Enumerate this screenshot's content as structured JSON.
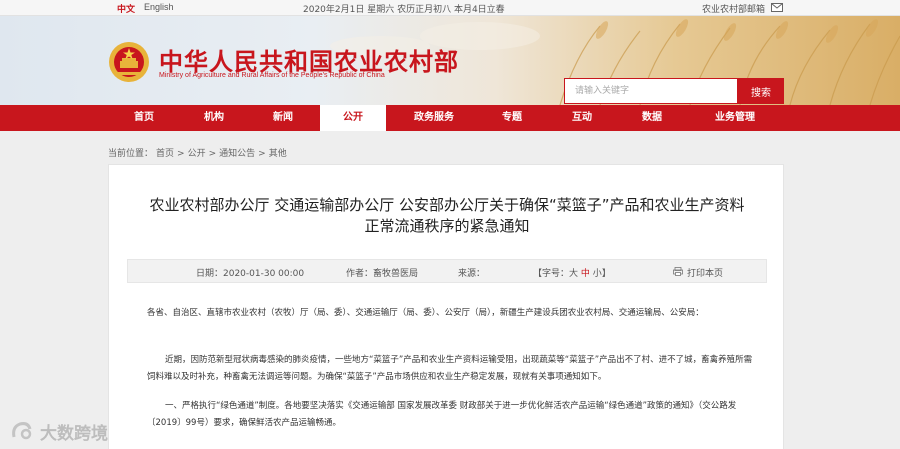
{
  "topbar": {
    "lang_zh": "中文",
    "lang_en": "English",
    "date_line": "2020年2月1日 星期六 农历正月初八 本月4日立春",
    "mailbox": "农业农村部邮箱"
  },
  "header": {
    "title": "中华人民共和国农业农村部",
    "subtitle": "Ministry of Agriculture and Rural Affairs of the People's Republic of China",
    "search_placeholder": "请输入关键字",
    "search_button": "搜索"
  },
  "nav": {
    "items": [
      {
        "label": "首页"
      },
      {
        "label": "机构"
      },
      {
        "label": "新闻"
      },
      {
        "label": "公开"
      },
      {
        "label": "政务服务"
      },
      {
        "label": "专题"
      },
      {
        "label": "互动"
      },
      {
        "label": "数据"
      },
      {
        "label": "业务管理"
      }
    ],
    "active": "公开"
  },
  "breadcrumb": {
    "prefix": "当前位置：",
    "items": [
      "首页",
      "公开",
      "通知公告",
      "其他"
    ],
    "separator": ">"
  },
  "article": {
    "title_line1": "农业农村部办公厅 交通运输部办公厅 公安部办公厅关于确保“菜篮子”产品和农业生产资料",
    "title_line2": "正常流通秩序的紧急通知",
    "date_label": "日期：2020-01-30 00:00",
    "author_label": "作者：畜牧兽医局",
    "source_label": "来源：",
    "fontsize_prefix": "【字号：",
    "fontsize_large": "大",
    "fontsize_mid": "中",
    "fontsize_small": "小",
    "fontsize_suffix": "】",
    "print_label": "打印本页",
    "p1": "各省、自治区、直辖市农业农村（农牧）厅（局、委）、交通运输厅（局、委）、公安厅（局），新疆生产建设兵团农业农村局、交通运输局、公安局：",
    "p2": "近期，因防范新型冠状病毒感染的肺炎疫情，一些地方“菜篮子”产品和农业生产资料运输受阻，出现蔬菜等“菜篮子”产品出不了村、进不了城，畜禽养殖所需饲料难以及时补充，种畜禽无法调运等问题。为确保“菜篮子”产品市场供应和农业生产稳定发展，现就有关事项通知如下。",
    "p3": "一、严格执行“绿色通道”制度。各地要坚决落实《交通运输部 国家发展改革委 财政部关于进一步优化鲜活农产品运输“绿色通道”政策的通知》（交公路发〔2019〕99号）要求，确保鲜活农产品运输畅通。"
  },
  "watermark": {
    "text": "大数跨境"
  },
  "colors": {
    "brand_red": "#c8161d",
    "page_bg": "#eeeeee"
  }
}
